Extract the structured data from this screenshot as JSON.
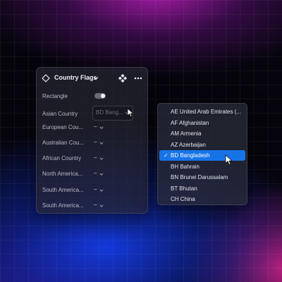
{
  "panel": {
    "title": "Country Flags",
    "frame_icon": "frame-diamond-icon",
    "menu_icon": "more-horizontal-icon",
    "move_icon": "move-cross-icon",
    "rows": [
      {
        "label": "Rectangle",
        "control": "toggle",
        "on": true
      },
      {
        "label": "Asian Country",
        "control": "select",
        "value": "BD Bang..."
      },
      {
        "label": "European Cou...",
        "control": "empty-select",
        "value": "–"
      },
      {
        "label": "Australian Cou...",
        "control": "empty-select",
        "value": "–"
      },
      {
        "label": "African Country",
        "control": "empty-select",
        "value": "–"
      },
      {
        "label": "North America...",
        "control": "empty-select",
        "value": "–"
      },
      {
        "label": "South America...",
        "control": "empty-select",
        "value": "–"
      },
      {
        "label": "South America...",
        "control": "empty-select",
        "value": "–"
      }
    ]
  },
  "dropdown": {
    "selected_index": 4,
    "check_mark": "✓",
    "options": [
      "AE United Arab Emirates (...",
      "AF Afghanistan",
      "AM Armenia",
      "AZ Azerbaijan",
      "BD Bangladesh",
      "BH Bahrain",
      "BN Brunei Darussalam",
      "BT Bhutan",
      "CH China"
    ]
  },
  "colors": {
    "accent": "#1774e6",
    "panel_bg": "#26263a",
    "text": "#e6e6ee"
  }
}
